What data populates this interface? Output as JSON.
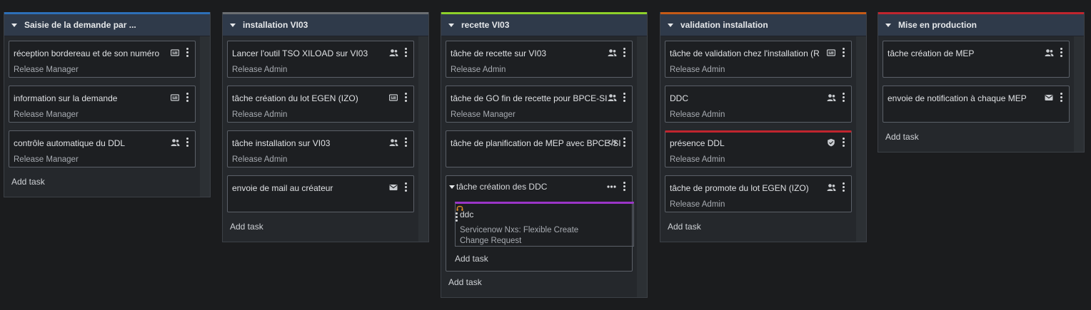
{
  "colors": {
    "lane1_accent": "#2d6fb8",
    "lane2_accent": "#6b6e72",
    "lane3_accent": "#8ed12a",
    "lane4_accent": "#c55a16",
    "lane5_accent": "#c0252e",
    "subtask_accent": "#9b35c8",
    "warning_accent": "#c0252e"
  },
  "lanes": [
    {
      "title": "Saisie de la demande par ...",
      "tasks": [
        {
          "title": "réception bordereau et de son numéro",
          "assignee": "Release Manager",
          "icon": "form-icon"
        },
        {
          "title": "information sur la demande",
          "assignee": "Release Manager",
          "icon": "form-icon"
        },
        {
          "title": "contrôle automatique du DDL",
          "assignee": "Release Manager",
          "icon": "group-icon"
        }
      ],
      "add_task": "Add task"
    },
    {
      "title": "installation VI03",
      "tasks": [
        {
          "title": "Lancer l'outil TSO XILOAD sur VI03",
          "assignee": "Release Admin",
          "icon": "group-icon"
        },
        {
          "title": "tâche création du lot EGEN (IZO)",
          "assignee": "Release Admin",
          "icon": "form-icon"
        },
        {
          "title": "tâche installation sur VI03",
          "assignee": "Release Admin",
          "icon": "group-icon"
        },
        {
          "title": "envoie de mail au créateur",
          "assignee": "",
          "icon": "mail-icon"
        }
      ],
      "add_task": "Add task"
    },
    {
      "title": "recette VI03",
      "tasks": [
        {
          "title": "tâche de recette sur VI03",
          "assignee": "Release Admin",
          "icon": "group-icon"
        },
        {
          "title": "tâche de GO fin de recette pour BPCE-SI",
          "assignee": "Release Manager",
          "icon": "group-icon"
        },
        {
          "title": "tâche de planification de MEP avec BPCE-SI",
          "assignee": "",
          "icon": "code-icon"
        }
      ],
      "group": {
        "title": "tâche création des DDC",
        "subtask": {
          "title": "ddc",
          "description": "Servicenow Nxs: Flexible Create Change Request",
          "icon": "headset-icon"
        },
        "add_task": "Add task"
      },
      "add_task": "Add task"
    },
    {
      "title": "validation installation",
      "tasks": [
        {
          "title": "tâche de validation chez l'installation (RZE)...",
          "assignee": "Release Admin",
          "icon": "form-icon"
        },
        {
          "title": "DDC",
          "assignee": "Release Admin",
          "icon": "group-icon"
        },
        {
          "title": "présence DDL",
          "assignee": "Release Admin",
          "icon": "shield-icon"
        },
        {
          "title": "tâche de promote du lot EGEN (IZO)",
          "assignee": "Release Admin",
          "icon": "group-icon"
        }
      ],
      "add_task": "Add task"
    },
    {
      "title": "Mise en production",
      "tasks": [
        {
          "title": "tâche création de MEP",
          "assignee": "",
          "icon": "group-icon"
        },
        {
          "title": "envoie de notification à chaque MEP",
          "assignee": "",
          "icon": "mail-icon"
        }
      ],
      "add_task": "Add task"
    }
  ]
}
